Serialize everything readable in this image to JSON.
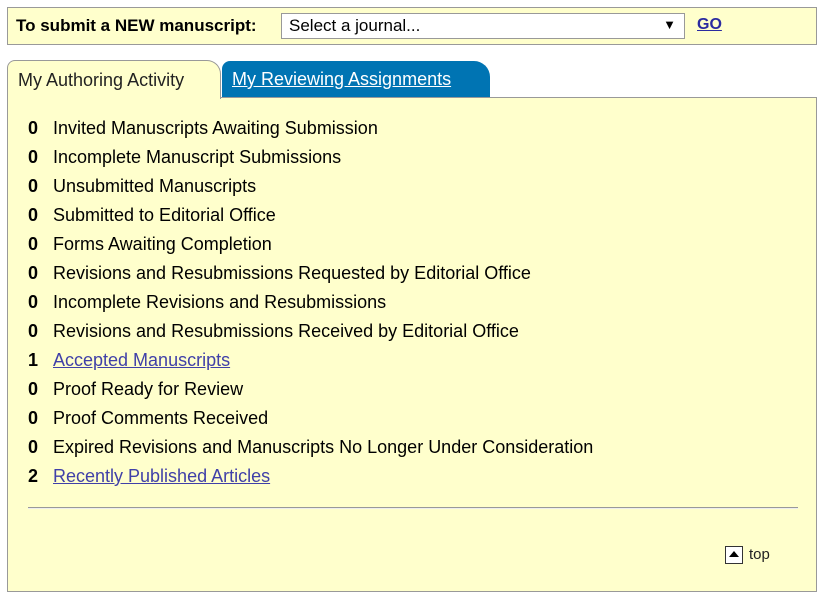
{
  "submit_bar": {
    "label": "To submit a NEW manuscript:",
    "journal_select": "Select a journal...",
    "go": "GO"
  },
  "tabs": [
    {
      "label": "My Authoring Activity",
      "active": true
    },
    {
      "label": "My Reviewing Assignments",
      "active": false
    }
  ],
  "items": [
    {
      "count": "0",
      "label": "Invited Manuscripts Awaiting Submission",
      "link": false
    },
    {
      "count": "0",
      "label": "Incomplete Manuscript Submissions",
      "link": false
    },
    {
      "count": "0",
      "label": "Unsubmitted Manuscripts",
      "link": false
    },
    {
      "count": "0",
      "label": "Submitted to Editorial Office",
      "link": false
    },
    {
      "count": "0",
      "label": "Forms Awaiting Completion",
      "link": false
    },
    {
      "count": "0",
      "label": "Revisions and Resubmissions Requested by Editorial Office",
      "link": false
    },
    {
      "count": "0",
      "label": "Incomplete Revisions and Resubmissions",
      "link": false
    },
    {
      "count": "0",
      "label": "Revisions and Resubmissions Received by Editorial Office",
      "link": false
    },
    {
      "count": "1",
      "label": "Accepted Manuscripts",
      "link": true
    },
    {
      "count": "0",
      "label": "Proof Ready for Review",
      "link": false
    },
    {
      "count": "0",
      "label": "Proof Comments Received",
      "link": false
    },
    {
      "count": "0",
      "label": "Expired Revisions and Manuscripts No Longer Under Consideration",
      "link": false
    },
    {
      "count": "2",
      "label": "Recently Published Articles",
      "link": true
    }
  ],
  "top_link": "top"
}
